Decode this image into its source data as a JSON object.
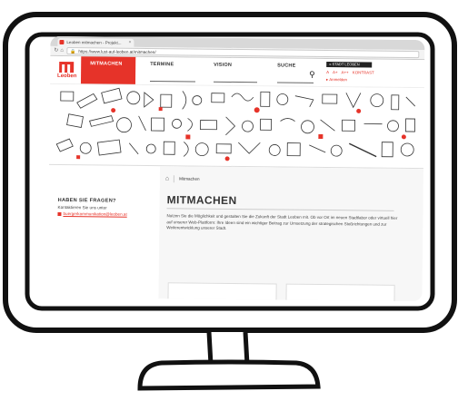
{
  "browser": {
    "tab_title": "Leoben mitmachen - Projekt...",
    "url": "https://www.lust-auf-leoben.at/mitmachen/"
  },
  "site": {
    "logo_text": "Leoben",
    "nav": [
      {
        "label": "MITMACHEN"
      },
      {
        "label": "TERMINE"
      },
      {
        "label": "VISION"
      },
      {
        "label": "SUCHE"
      }
    ],
    "stadt_link": "» STADT LEOBEN",
    "font_controls": [
      "A",
      "A+",
      "A++",
      "KONTRAST"
    ],
    "login": "Anmelden"
  },
  "sidebar": {
    "title": "HABEN SIE FRAGEN?",
    "text": "Kontaktieren Sie uns unter",
    "email": "buergerkommunikation@leoben.at"
  },
  "main": {
    "breadcrumb": "Mitmachen",
    "title": "MITMACHEN",
    "intro": "Nutzen Sie die Möglichkeit und gestalten Sie die Zukunft der Stadt Leoben mit. Ob vor Ort im neuen Stadtlabor oder virtuell hier auf unserer Web-Plattform: Ihre Ideen sind ein wichtiger Beitrag zur Umsetzung der strategischen Stoßrichtungen und zur Weiterentwicklung unserer Stadt."
  },
  "colors": {
    "brand": "#e63329",
    "text": "#333333"
  }
}
